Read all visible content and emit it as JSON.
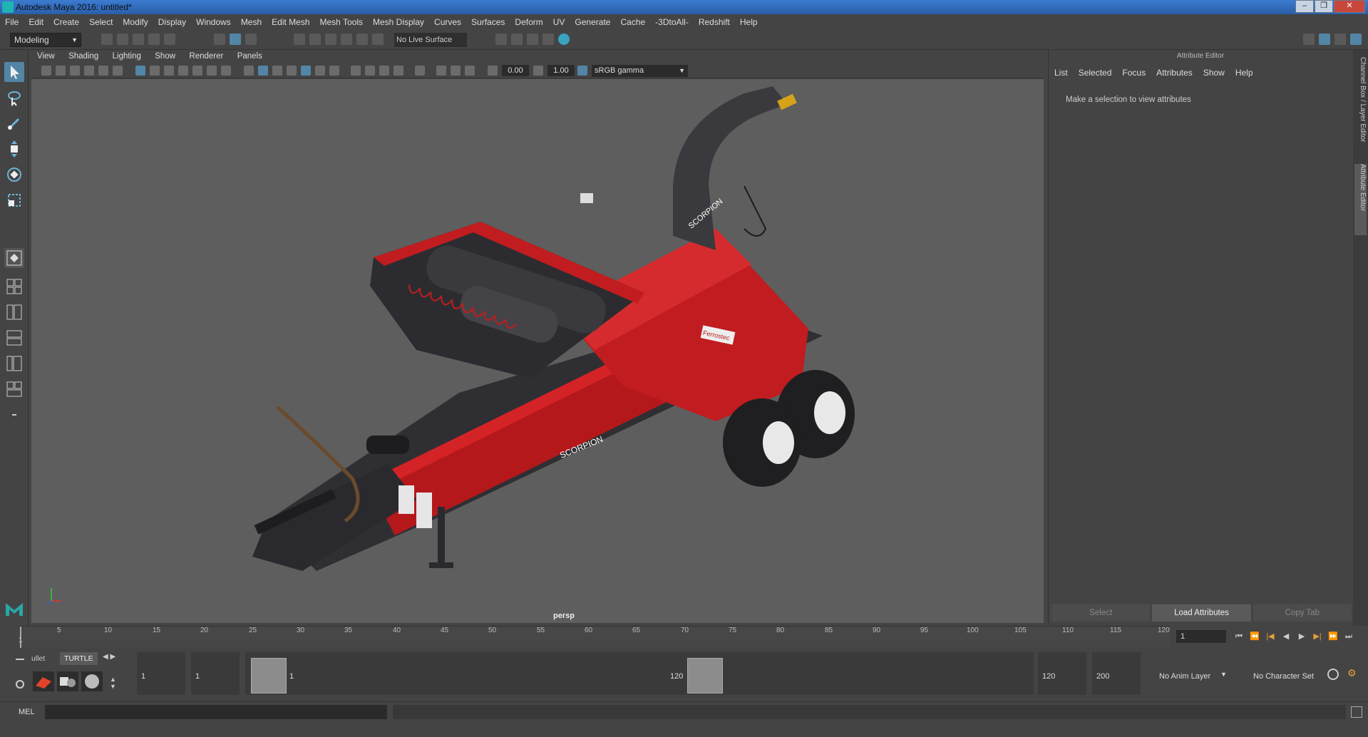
{
  "window": {
    "title": "Autodesk Maya 2016: untitled*",
    "buttons": [
      "–",
      "❐",
      "✕"
    ]
  },
  "menubar": [
    "File",
    "Edit",
    "Create",
    "Select",
    "Modify",
    "Display",
    "Windows",
    "Mesh",
    "Edit Mesh",
    "Mesh Tools",
    "Mesh Display",
    "Curves",
    "Surfaces",
    "Deform",
    "UV",
    "Generate",
    "Cache",
    "-3DtoAll-",
    "Redshift",
    "Help"
  ],
  "shelf": {
    "mode": "Modeling",
    "live_surface": "No Live Surface"
  },
  "viewport": {
    "menu": [
      "View",
      "Shading",
      "Lighting",
      "Show",
      "Renderer",
      "Panels"
    ],
    "exposure": "0.00",
    "gamma": "1.00",
    "color_space": "sRGB gamma",
    "camera": "persp",
    "model_logo_1": "SCORPION",
    "model_logo_2": "SCORPION",
    "model_logo_3": "Ferrostec"
  },
  "attribute_editor": {
    "title": "Attribute Editor",
    "menu": [
      "List",
      "Selected",
      "Focus",
      "Attributes",
      "Show",
      "Help"
    ],
    "message": "Make a selection to view attributes",
    "buttons": [
      "Select",
      "Load Attributes",
      "Copy Tab"
    ],
    "side_tabs": [
      "Channel Box / Layer Editor",
      "Attribute Editor"
    ]
  },
  "timeline": {
    "ticks": [
      "1",
      "5",
      "10",
      "15",
      "20",
      "25",
      "30",
      "35",
      "40",
      "45",
      "50",
      "55",
      "60",
      "65",
      "70",
      "75",
      "80",
      "85",
      "90",
      "95",
      "100",
      "105",
      "110",
      "115",
      "120"
    ],
    "current_frame": "1"
  },
  "range": {
    "shelf_tabs": [
      "ullet",
      "TURTLE"
    ],
    "start": "1",
    "playback_start": "1",
    "handle_start": "1",
    "handle_end": "120",
    "playback_end": "120",
    "end": "200",
    "anim_layer": "No Anim Layer",
    "char_set": "No Character Set"
  },
  "command": {
    "label": "MEL"
  }
}
